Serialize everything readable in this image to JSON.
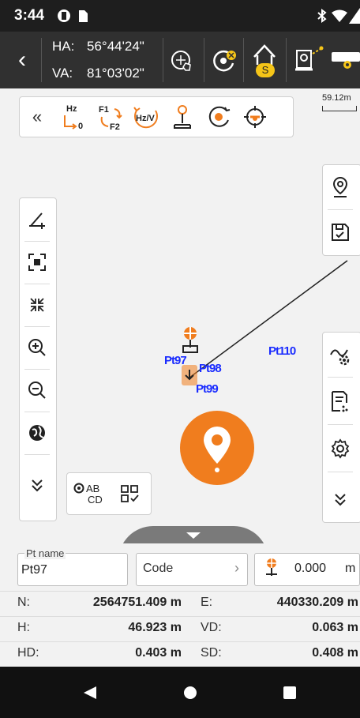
{
  "status_bar": {
    "time": "3:44"
  },
  "topbar": {
    "ha_label": "HA:",
    "ha_value": "56°44'24\"",
    "va_label": "VA:",
    "va_value": "81°03'02\"",
    "stakeout_badge": "S"
  },
  "toolbar": {
    "collapse_label": "«",
    "hz0_top": "Hz",
    "hz0_bottom": "0",
    "f1_label": "F1",
    "f2_label": "F2",
    "hzv_label": "Hz/V"
  },
  "map": {
    "scale_label": "59.12m",
    "label_ptr10": "Pt110",
    "label_pt98": "Pt98",
    "label_center": "Pt97",
    "label_under": "Pt99"
  },
  "left_tools": {
    "abcd_top": "AB",
    "abcd_bottom": "CD"
  },
  "bottom": {
    "pt_name_label": "Pt name",
    "pt_name_value": "Pt97",
    "code_placeholder": "Code",
    "height_value": "0.000",
    "height_unit": "m",
    "n_label": "N:",
    "n_value": "2564751.409 m",
    "e_label": "E:",
    "e_value": "440330.209 m",
    "h_label": "H:",
    "h_value": "46.923 m",
    "vd_label": "VD:",
    "vd_value": "0.063 m",
    "hd_label": "HD:",
    "hd_value": "0.403 m",
    "sd_label": "SD:",
    "sd_value": "0.408 m"
  },
  "colors": {
    "accent_orange": "#f07d1e",
    "badge_yellow": "#f5c518",
    "point_blue": "#1a2cff"
  }
}
